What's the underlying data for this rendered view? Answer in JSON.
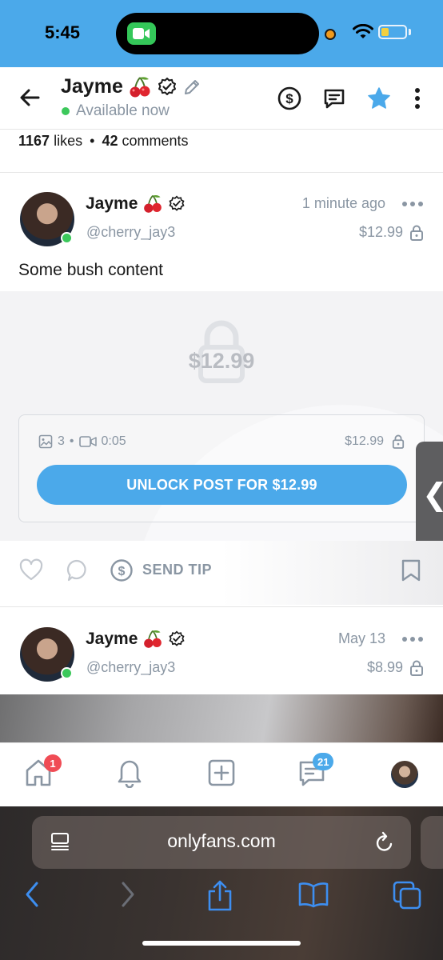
{
  "status_bar": {
    "time": "5:45",
    "background": "#4ba9ea"
  },
  "profile": {
    "name": "Jayme",
    "status": "Available now",
    "icons": [
      "back-arrow-icon",
      "cherry-icon",
      "verified-icon",
      "edit-pencil-icon",
      "dollar-icon",
      "message-icon",
      "star-icon",
      "more-vertical-icon"
    ]
  },
  "stats": {
    "likes_count": "1167",
    "likes_label": "likes",
    "separator": "•",
    "comments_count": "42",
    "comments_label": "comments"
  },
  "post1": {
    "name": "Jayme",
    "handle": "@cherry_jay3",
    "time": "1 minute ago",
    "price": "$12.99",
    "text": "Some bush content",
    "locked_price": "$12.99",
    "media_images": "3",
    "media_sep": "•",
    "media_video_duration": "0:05",
    "card_price": "$12.99",
    "unlock_label": "UNLOCK POST FOR $12.99",
    "send_tip_label": "SEND TIP"
  },
  "post2": {
    "name": "Jayme",
    "handle": "@cherry_jay3",
    "time": "May 13",
    "price": "$8.99"
  },
  "side_handle": {
    "label": "❮"
  },
  "bottom_nav": {
    "items": [
      "home-icon",
      "notifications-icon",
      "new-post-icon",
      "messages-icon",
      "profile-avatar"
    ],
    "home_badge": "1",
    "messages_badge": "21"
  },
  "browser": {
    "url": "onlyfans.com"
  },
  "colors": {
    "accent": "#4ba9ea",
    "muted": "#8a96a3",
    "badge_red": "#f04c55",
    "online": "#3cc85b"
  }
}
